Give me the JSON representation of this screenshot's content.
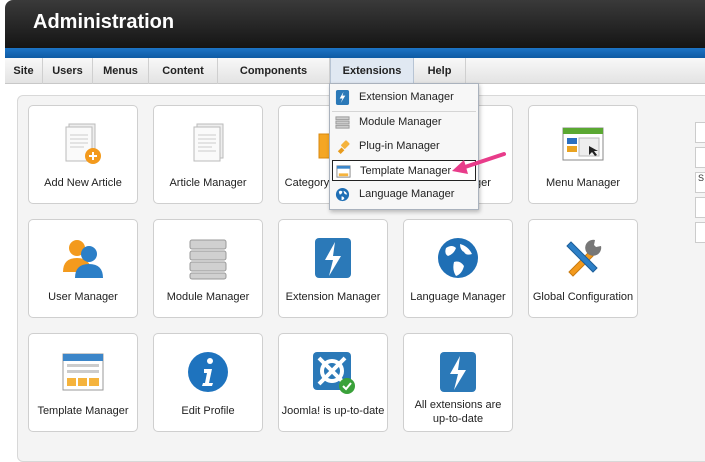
{
  "header": {
    "title": "Administration"
  },
  "menu": [
    {
      "label": "Site"
    },
    {
      "label": "Users"
    },
    {
      "label": "Menus"
    },
    {
      "label": "Content"
    },
    {
      "label": "Components"
    },
    {
      "label": "Extensions"
    },
    {
      "label": "Help"
    }
  ],
  "dropdown": [
    {
      "label": "Extension Manager",
      "icon": "extension-bolt-icon"
    },
    {
      "label": "Module Manager",
      "icon": "module-stack-icon"
    },
    {
      "label": "Plug-in Manager",
      "icon": "plugin-icon"
    },
    {
      "label": "Template Manager",
      "icon": "template-icon"
    },
    {
      "label": "Language Manager",
      "icon": "globe-icon"
    }
  ],
  "tiles": [
    {
      "label": "Add New Article",
      "icon": "add-article-icon"
    },
    {
      "label": "Article Manager",
      "icon": "article-icon"
    },
    {
      "label": "Category",
      "icon": "category-folder-icon"
    },
    {
      "label": "ger",
      "icon": ""
    },
    {
      "label": "Menu Manager",
      "icon": "menu-manager-icon"
    },
    {
      "label": "User Manager",
      "icon": "users-icon"
    },
    {
      "label": "Module Manager",
      "icon": "module-stack-icon"
    },
    {
      "label": "Extension Manager",
      "icon": "extension-bolt-icon"
    },
    {
      "label": "Language Manager",
      "icon": "globe-icon"
    },
    {
      "label": "Global Configuration",
      "icon": "tools-icon"
    },
    {
      "label": "Template Manager",
      "icon": "template-icon"
    },
    {
      "label": "Edit Profile",
      "icon": "info-icon"
    },
    {
      "label": "Joomla! is up-to-date",
      "icon": "joomla-check-icon"
    },
    {
      "label": "All extensions are up-to-date",
      "icon": "extension-bolt-icon"
    }
  ],
  "side": {
    "fragment": "S"
  }
}
